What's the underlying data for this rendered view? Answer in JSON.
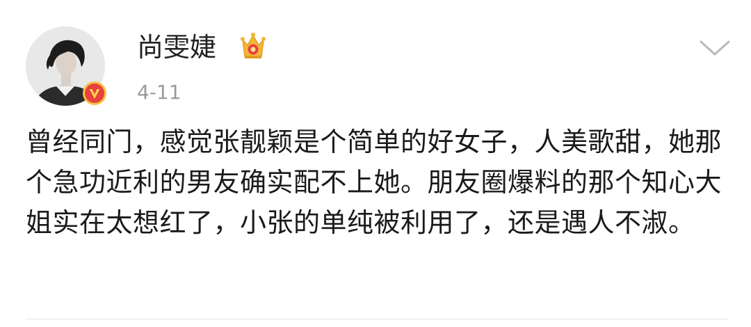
{
  "post": {
    "user_name": "尚雯婕",
    "time": "4-11",
    "content": "曾经同门，感觉张靓颖是个简单的好女子，人美歌甜，她那个急功近利的男友确实配不上她。朋友圈爆料的那个知心大姐实在太想红了，小张的单纯被利用了，还是遇人不淑。",
    "icons": {
      "verified": "verified-v-icon",
      "crown": "crown-icon",
      "more": "chevron-down-icon"
    },
    "colors": {
      "verified_badge": "#e8413e",
      "verified_ring": "#f5c242",
      "crown": "#f3b83a",
      "time_text": "#9a9a9a"
    }
  }
}
